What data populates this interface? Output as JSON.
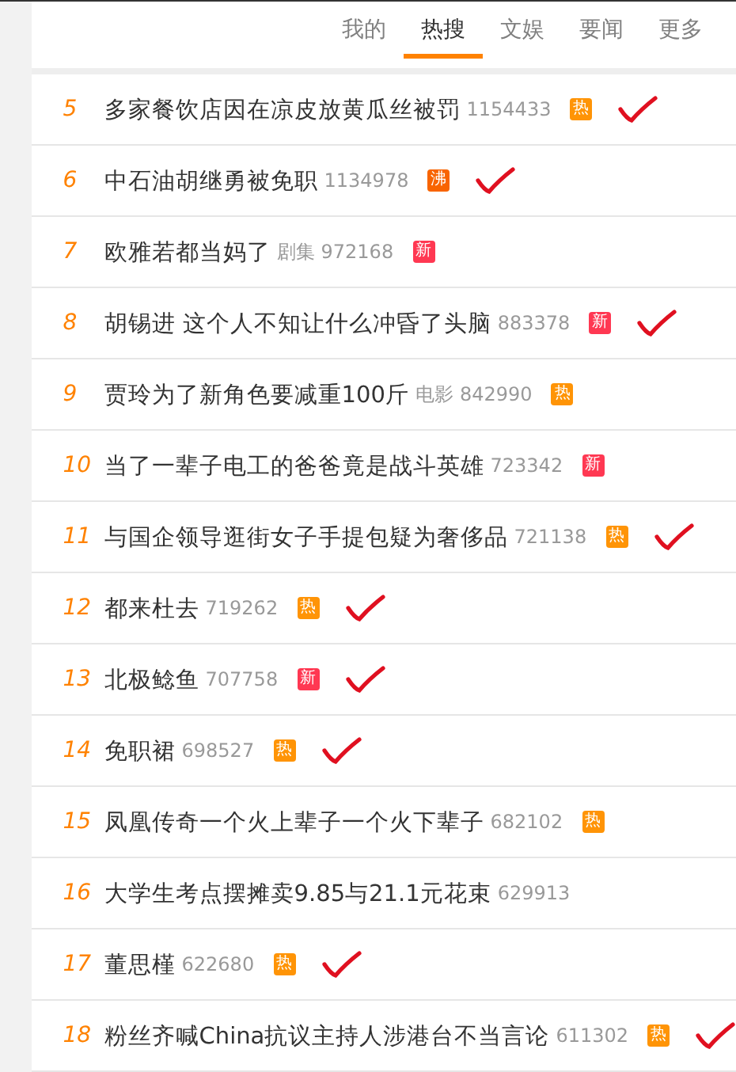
{
  "tabs": [
    {
      "label": "我的",
      "selected": false
    },
    {
      "label": "热搜",
      "selected": true
    },
    {
      "label": "文娱",
      "selected": false
    },
    {
      "label": "要闻",
      "selected": false
    },
    {
      "label": "更多",
      "selected": false
    }
  ],
  "rows": [
    {
      "rank": "5",
      "title": "多家餐饮店因在凉皮放黄瓜丝被罚",
      "count": "1154433",
      "badge": {
        "kind": "hot",
        "label": "热"
      },
      "ticked": true
    },
    {
      "rank": "6",
      "title": "中石油胡继勇被免职",
      "count": "1134978",
      "badge": {
        "kind": "boil",
        "label": "沸"
      },
      "ticked": true
    },
    {
      "rank": "7",
      "title": "欧雅若都当妈了",
      "category": "剧集",
      "count": "972168",
      "badge": {
        "kind": "new",
        "label": "新"
      },
      "ticked": false
    },
    {
      "rank": "8",
      "title": "胡锡进 这个人不知让什么冲昏了头脑",
      "count": "883378",
      "badge": {
        "kind": "new",
        "label": "新"
      },
      "ticked": true
    },
    {
      "rank": "9",
      "title": "贾玲为了新角色要减重100斤",
      "category": "电影",
      "count": "842990",
      "badge": {
        "kind": "hot",
        "label": "热"
      },
      "ticked": false
    },
    {
      "rank": "10",
      "title": "当了一辈子电工的爸爸竟是战斗英雄",
      "count": "723342",
      "badge": {
        "kind": "new",
        "label": "新"
      },
      "ticked": false
    },
    {
      "rank": "11",
      "title": "与国企领导逛街女子手提包疑为奢侈品",
      "count": "721138",
      "badge": {
        "kind": "hot",
        "label": "热"
      },
      "ticked": true
    },
    {
      "rank": "12",
      "title": "都来杜去",
      "count": "719262",
      "badge": {
        "kind": "hot",
        "label": "热"
      },
      "ticked": true
    },
    {
      "rank": "13",
      "title": "北极鲶鱼",
      "count": "707758",
      "badge": {
        "kind": "new",
        "label": "新"
      },
      "ticked": true
    },
    {
      "rank": "14",
      "title": "免职裙",
      "count": "698527",
      "badge": {
        "kind": "hot",
        "label": "热"
      },
      "ticked": true
    },
    {
      "rank": "15",
      "title": "凤凰传奇一个火上辈子一个火下辈子",
      "count": "682102",
      "badge": {
        "kind": "hot",
        "label": "热"
      },
      "ticked": false
    },
    {
      "rank": "16",
      "title": "大学生考点摆摊卖9.85与21.1元花束",
      "count": "629913",
      "ticked": false
    },
    {
      "rank": "17",
      "title": "董思槿",
      "count": "622680",
      "badge": {
        "kind": "hot",
        "label": "热"
      },
      "ticked": true
    },
    {
      "rank": "18",
      "title": "粉丝齐喊China抗议主持人涉港台不当言论",
      "count": "611302",
      "badge": {
        "kind": "hot",
        "label": "热"
      },
      "ticked": true
    }
  ]
}
